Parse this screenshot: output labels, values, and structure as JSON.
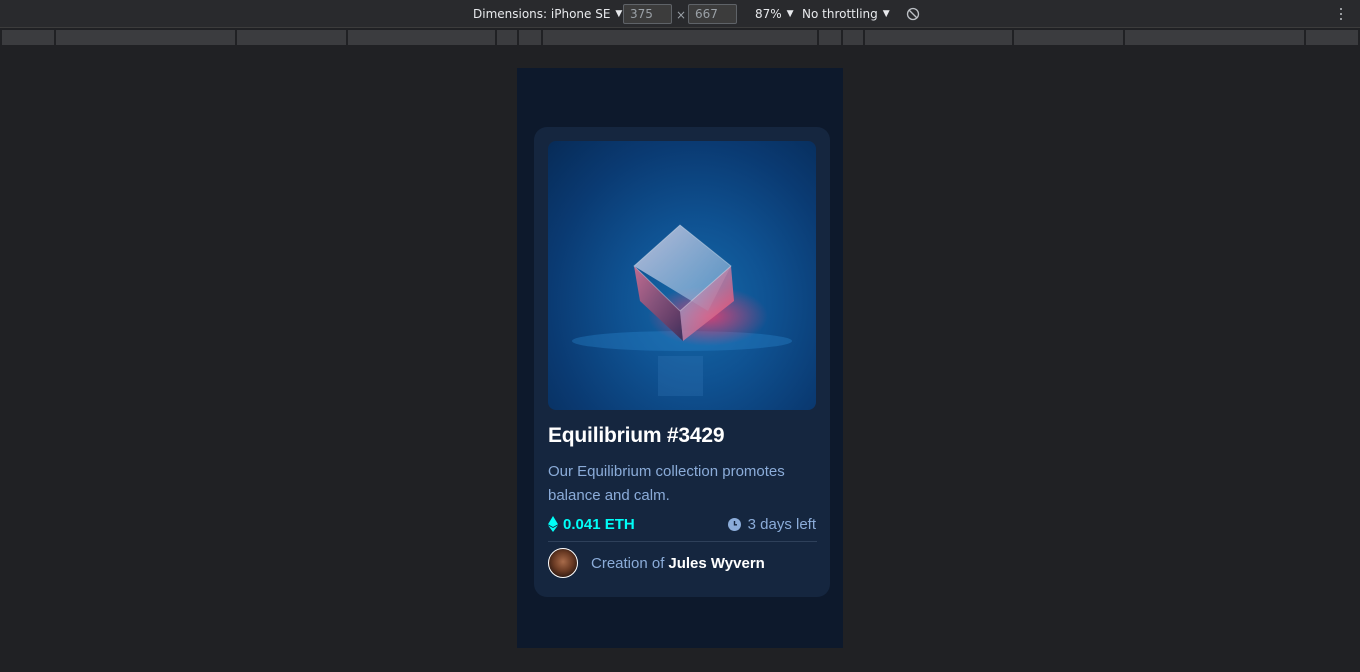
{
  "devtools": {
    "device_label": "Dimensions: iPhone SE",
    "width_value": "375",
    "height_value": "667",
    "times_symbol": "×",
    "zoom": "87%",
    "throttling": "No throttling",
    "icons": [
      "caret-down-icon",
      "rotate-icon",
      "more-options-icon"
    ]
  },
  "card": {
    "title": "Equilibrium #3429",
    "description": "Our Equilibrium collection promotes balance and calm.",
    "price": "0.041 ETH",
    "time_left": "3 days left",
    "creator_prefix": "Creation of",
    "creator_name": "Jules Wyvern",
    "icons": [
      "ethereum-icon",
      "clock-icon"
    ]
  },
  "colors": {
    "page_bg": "#0d192c",
    "card_bg": "#15263f",
    "accent_cyan": "#00fff8",
    "soft_blue": "#8bacd9",
    "white": "#ffffff",
    "devtools_bg": "#202124"
  }
}
